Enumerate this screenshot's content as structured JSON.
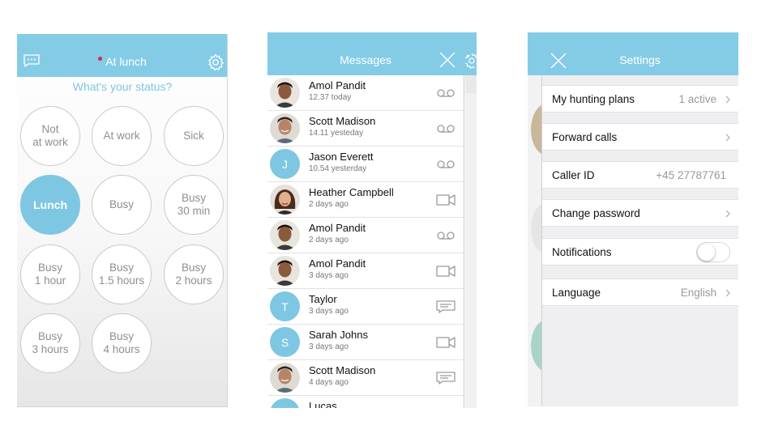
{
  "status_screen": {
    "title": "At lunch",
    "question": "What's your status?",
    "options": [
      {
        "label": "Not\nat work",
        "active": false
      },
      {
        "label": "At work",
        "active": false
      },
      {
        "label": "Sick",
        "active": false
      },
      {
        "label": "Lunch",
        "active": true
      },
      {
        "label": "Busy",
        "active": false
      },
      {
        "label": "Busy\n30 min",
        "active": false
      },
      {
        "label": "Busy\n1 hour",
        "active": false
      },
      {
        "label": "Busy\n1.5 hours",
        "active": false
      },
      {
        "label": "Busy\n2 hours",
        "active": false
      },
      {
        "label": "Busy\n3 hours",
        "active": false
      },
      {
        "label": "Busy\n4 hours",
        "active": false
      }
    ],
    "icons": {
      "left": "chat-icon",
      "right": "gear-icon"
    },
    "status_dot_color": "#d8264a"
  },
  "messages_screen": {
    "title": "Messages",
    "items": [
      {
        "name": "Amol Pandit",
        "time": "12.37 today",
        "avatar": "photo-man-dark-hair",
        "type": "voicemail-icon"
      },
      {
        "name": "Scott Madison",
        "time": "14.11 yesteday",
        "avatar": "photo-man-smiling",
        "type": "voicemail-icon"
      },
      {
        "name": "Jason Everett",
        "time": "10.54 yesterday",
        "avatar_initial": "J",
        "type": "voicemail-icon"
      },
      {
        "name": "Heather Campbell",
        "time": "2 days ago",
        "avatar": "photo-woman",
        "type": "video-icon"
      },
      {
        "name": "Amol Pandit",
        "time": "2 days ago",
        "avatar": "photo-man-dark-hair",
        "type": "voicemail-icon"
      },
      {
        "name": "Amol Pandit",
        "time": "3 days ago",
        "avatar": "photo-man-dark-hair",
        "type": "video-icon"
      },
      {
        "name": "Taylor",
        "time": "3 days ago",
        "avatar_initial": "T",
        "type": "message-icon"
      },
      {
        "name": "Sarah Johns",
        "time": "3 days ago",
        "avatar_initial": "S",
        "type": "video-icon"
      },
      {
        "name": "Scott Madison",
        "time": "4 days ago",
        "avatar": "photo-man-smiling",
        "type": "message-icon"
      },
      {
        "name": "Lucas",
        "time": "",
        "avatar_initial": "L",
        "type": "voicemail-icon"
      }
    ]
  },
  "settings_screen": {
    "title": "Settings",
    "rows": [
      {
        "label": "My hunting plans",
        "value": "1 active",
        "chevron": true
      },
      {
        "label": "Forward calls",
        "value": "",
        "chevron": true
      },
      {
        "label": "Caller ID",
        "value": "+45 27787761",
        "chevron": false
      },
      {
        "label": "Change password",
        "value": "",
        "chevron": true
      },
      {
        "label": "Notifications",
        "toggle": false
      },
      {
        "label": "Language",
        "value": "English",
        "chevron": true
      }
    ]
  },
  "colors": {
    "accent": "#84cce6",
    "active_circle": "#7ec7e3"
  }
}
